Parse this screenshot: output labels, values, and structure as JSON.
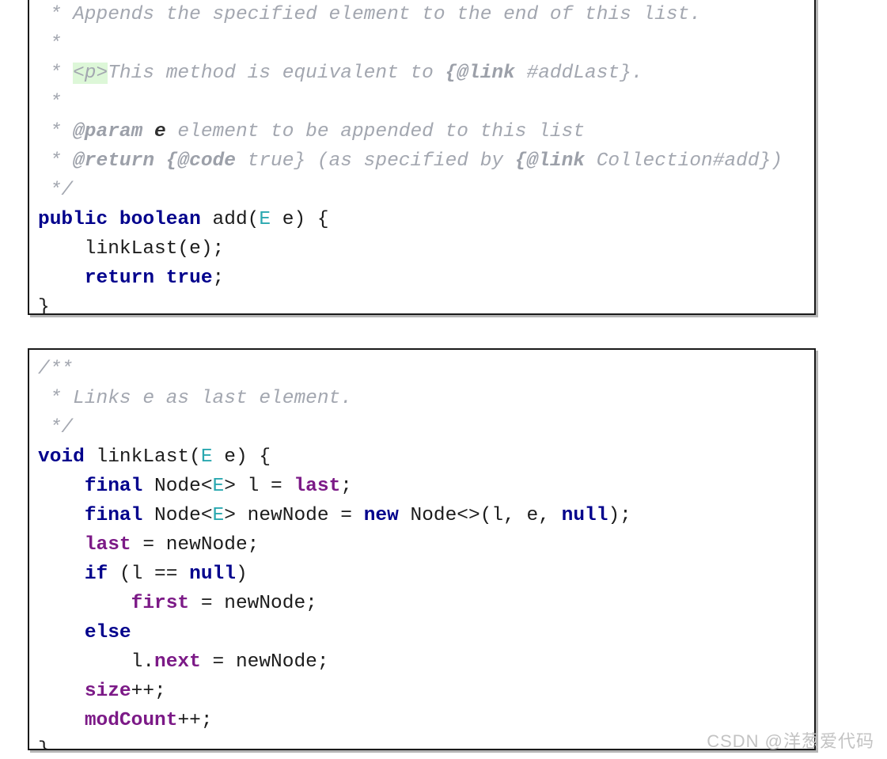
{
  "page": {
    "background": "#ffffff",
    "watermark": "CSDN @洋葱爱代码"
  },
  "colors": {
    "keyword": "#00008c",
    "comment": "#a3a7b0",
    "comment_tag": "#9ca0a9",
    "generic_type": "#2aa8b0",
    "field": "#7c1a87",
    "plain_text": "#1c1c1c",
    "highlight_background": "#ddf7d8",
    "box_border": "#1a1a1a",
    "watermark": "#c3c3c3"
  },
  "blocks": [
    {
      "id": "add-method",
      "language": "java",
      "lines": [
        {
          "segments": [
            {
              "t": " * Appends the specified element to the end of this list.",
              "c": "cm"
            }
          ]
        },
        {
          "segments": [
            {
              "t": " *",
              "c": "cm"
            }
          ]
        },
        {
          "segments": [
            {
              "t": " * ",
              "c": "cm"
            },
            {
              "t": "<p>",
              "c": "cmhl"
            },
            {
              "t": "This method is equivalent to ",
              "c": "cm"
            },
            {
              "t": "{@link",
              "c": "cmt"
            },
            {
              "t": " #addLast}.",
              "c": "cm"
            }
          ]
        },
        {
          "segments": [
            {
              "t": " *",
              "c": "cm"
            }
          ]
        },
        {
          "segments": [
            {
              "t": " * ",
              "c": "cm"
            },
            {
              "t": "@param",
              "c": "cmt"
            },
            {
              "t": " ",
              "c": "cm"
            },
            {
              "t": "e",
              "c": "cmb"
            },
            {
              "t": " element to be appended to this list",
              "c": "cm"
            }
          ]
        },
        {
          "segments": [
            {
              "t": " * ",
              "c": "cm"
            },
            {
              "t": "@return",
              "c": "cmt"
            },
            {
              "t": " ",
              "c": "cm"
            },
            {
              "t": "{@code",
              "c": "cmt"
            },
            {
              "t": " true} (as specified by ",
              "c": "cm"
            },
            {
              "t": "{@link",
              "c": "cmt"
            },
            {
              "t": " Collection#add})",
              "c": "cm"
            }
          ]
        },
        {
          "segments": [
            {
              "t": " */",
              "c": "cm"
            }
          ]
        },
        {
          "segments": [
            {
              "t": "public boolean",
              "c": "kw"
            },
            {
              "t": " add(",
              "c": "pl"
            },
            {
              "t": "E",
              "c": "gen"
            },
            {
              "t": " e) {",
              "c": "pl"
            }
          ]
        },
        {
          "segments": [
            {
              "t": "    linkLast(e);",
              "c": "pl"
            }
          ]
        },
        {
          "segments": [
            {
              "t": "    ",
              "c": "pl"
            },
            {
              "t": "return true",
              "c": "kw"
            },
            {
              "t": ";",
              "c": "pl"
            }
          ]
        },
        {
          "segments": [
            {
              "t": "}",
              "c": "pl"
            }
          ]
        }
      ]
    },
    {
      "id": "linklast-method",
      "language": "java",
      "lines": [
        {
          "segments": [
            {
              "t": "/**",
              "c": "cm"
            }
          ]
        },
        {
          "segments": [
            {
              "t": " * Links e as last element.",
              "c": "cm"
            }
          ]
        },
        {
          "segments": [
            {
              "t": " */",
              "c": "cm"
            }
          ]
        },
        {
          "segments": [
            {
              "t": "void",
              "c": "kw"
            },
            {
              "t": " linkLast(",
              "c": "pl"
            },
            {
              "t": "E",
              "c": "gen"
            },
            {
              "t": " e) {",
              "c": "pl"
            }
          ]
        },
        {
          "segments": [
            {
              "t": "    ",
              "c": "pl"
            },
            {
              "t": "final",
              "c": "kw"
            },
            {
              "t": " Node<",
              "c": "pl"
            },
            {
              "t": "E",
              "c": "gen"
            },
            {
              "t": "> l = ",
              "c": "pl"
            },
            {
              "t": "last",
              "c": "fld"
            },
            {
              "t": ";",
              "c": "pl"
            }
          ]
        },
        {
          "segments": [
            {
              "t": "    ",
              "c": "pl"
            },
            {
              "t": "final",
              "c": "kw"
            },
            {
              "t": " Node<",
              "c": "pl"
            },
            {
              "t": "E",
              "c": "gen"
            },
            {
              "t": "> newNode = ",
              "c": "pl"
            },
            {
              "t": "new",
              "c": "kw"
            },
            {
              "t": " Node<>(l, e, ",
              "c": "pl"
            },
            {
              "t": "null",
              "c": "kw"
            },
            {
              "t": ");",
              "c": "pl"
            }
          ]
        },
        {
          "segments": [
            {
              "t": "    ",
              "c": "pl"
            },
            {
              "t": "last",
              "c": "fld"
            },
            {
              "t": " = newNode;",
              "c": "pl"
            }
          ]
        },
        {
          "segments": [
            {
              "t": "    ",
              "c": "pl"
            },
            {
              "t": "if",
              "c": "kw"
            },
            {
              "t": " (l == ",
              "c": "pl"
            },
            {
              "t": "null",
              "c": "kw"
            },
            {
              "t": ")",
              "c": "pl"
            }
          ]
        },
        {
          "segments": [
            {
              "t": "        ",
              "c": "pl"
            },
            {
              "t": "first",
              "c": "fld"
            },
            {
              "t": " = newNode;",
              "c": "pl"
            }
          ]
        },
        {
          "segments": [
            {
              "t": "    ",
              "c": "pl"
            },
            {
              "t": "else",
              "c": "kw"
            }
          ]
        },
        {
          "segments": [
            {
              "t": "        l.",
              "c": "pl"
            },
            {
              "t": "next",
              "c": "fld"
            },
            {
              "t": " = newNode;",
              "c": "pl"
            }
          ]
        },
        {
          "segments": [
            {
              "t": "    ",
              "c": "pl"
            },
            {
              "t": "size",
              "c": "fld"
            },
            {
              "t": "++;",
              "c": "pl"
            }
          ]
        },
        {
          "segments": [
            {
              "t": "    ",
              "c": "pl"
            },
            {
              "t": "modCount",
              "c": "fld"
            },
            {
              "t": "++;",
              "c": "pl"
            }
          ]
        },
        {
          "segments": [
            {
              "t": "}",
              "c": "pl"
            }
          ]
        }
      ]
    }
  ]
}
